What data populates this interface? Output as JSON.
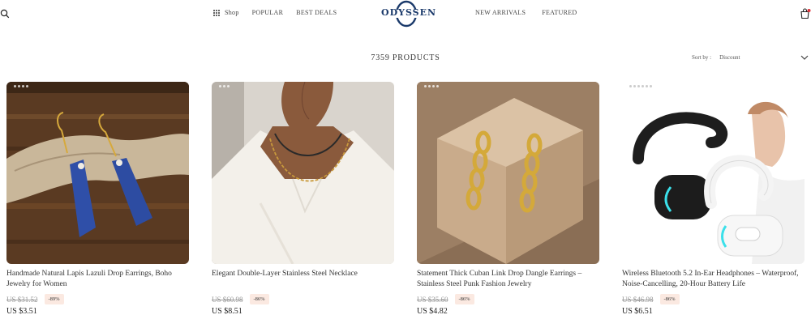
{
  "header": {
    "nav_left": {
      "shop": "Shop",
      "popular": "POPULAR",
      "best_deals": "BEST DEALS"
    },
    "logo_text": "ODYSSEN",
    "nav_right": {
      "new_arrivals": "NEW ARRIVALS",
      "featured": "FEATURED"
    },
    "icons": {
      "search": "search-icon",
      "cart": "cart-icon",
      "grid": "grid-icon"
    }
  },
  "toolbar": {
    "products_count": "7359 PRODUCTS",
    "sort_label": "Sort by :",
    "sort_value": "Discount"
  },
  "products": [
    {
      "title": "Handmade Natural Lapis Lazuli Drop Earrings, Boho Jewelry for Women",
      "old_price": "US $31.52",
      "discount": "-89%",
      "new_price": "US $3.51"
    },
    {
      "title": "Elegant Double-Layer Stainless Steel Necklace",
      "old_price": "US $60.98",
      "discount": "-86%",
      "new_price": "US $8.51"
    },
    {
      "title": "Statement Thick Cuban Link Drop Dangle Earrings – Stainless Steel Punk Fashion Jewelry",
      "old_price": "US $35.60",
      "discount": "-86%",
      "new_price": "US $4.82"
    },
    {
      "title": "Wireless Bluetooth 5.2 In-Ear Headphones – Waterproof, Noise-Cancelling, 20-Hour Battery Life",
      "old_price": "US $46.98",
      "discount": "-86%",
      "new_price": "US $6.51"
    }
  ],
  "colors": {
    "logo": "#1b3a6b",
    "discount_bg": "#fbe9e1",
    "cart_badge": "#e0333b"
  }
}
